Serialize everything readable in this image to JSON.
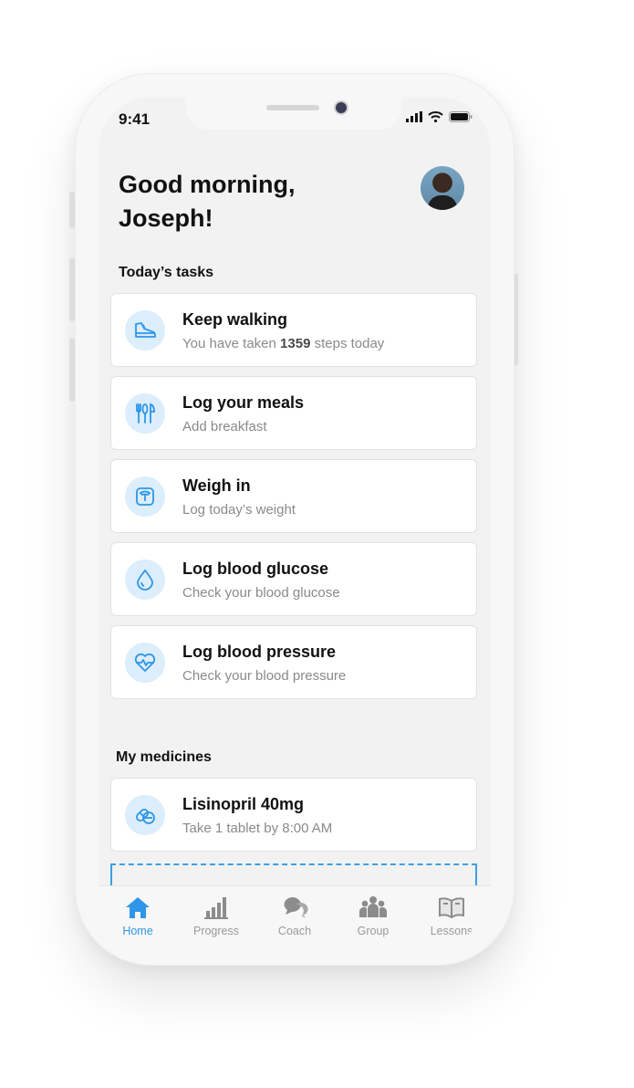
{
  "status": {
    "time": "9:41"
  },
  "greeting": "Good morning, Joseph!",
  "tasks_section": {
    "title": "Today’s tasks",
    "items": [
      {
        "title": "Keep walking",
        "subtitle_prefix": "You have taken ",
        "subtitle_value": "1359",
        "subtitle_suffix": " steps today",
        "icon": "sneaker-icon"
      },
      {
        "title": "Log your meals",
        "subtitle": "Add breakfast",
        "icon": "utensils-icon"
      },
      {
        "title": "Weigh in",
        "subtitle": "Log today’s weight",
        "icon": "scale-icon"
      },
      {
        "title": "Log blood glucose",
        "subtitle": "Check your blood glucose",
        "icon": "drop-icon"
      },
      {
        "title": "Log blood pressure",
        "subtitle": "Check your blood pressure",
        "icon": "heartbeat-icon"
      }
    ]
  },
  "medicines_section": {
    "title": "My medicines",
    "items": [
      {
        "title": "Lisinopril 40mg",
        "subtitle": "Take 1 tablet by 8:00 AM",
        "icon": "pill-icon"
      }
    ]
  },
  "tabbar": {
    "items": [
      {
        "label": "Home",
        "icon": "home-icon",
        "active": true
      },
      {
        "label": "Progress",
        "icon": "bar-chart-icon"
      },
      {
        "label": "Coach",
        "icon": "chat-bubbles-icon"
      },
      {
        "label": "Group",
        "icon": "group-icon"
      },
      {
        "label": "Lessons",
        "icon": "book-icon"
      }
    ]
  },
  "colors": {
    "accent": "#2d96e8",
    "icon_bg": "#dcedfb",
    "inactive": "#9a9a9a"
  }
}
